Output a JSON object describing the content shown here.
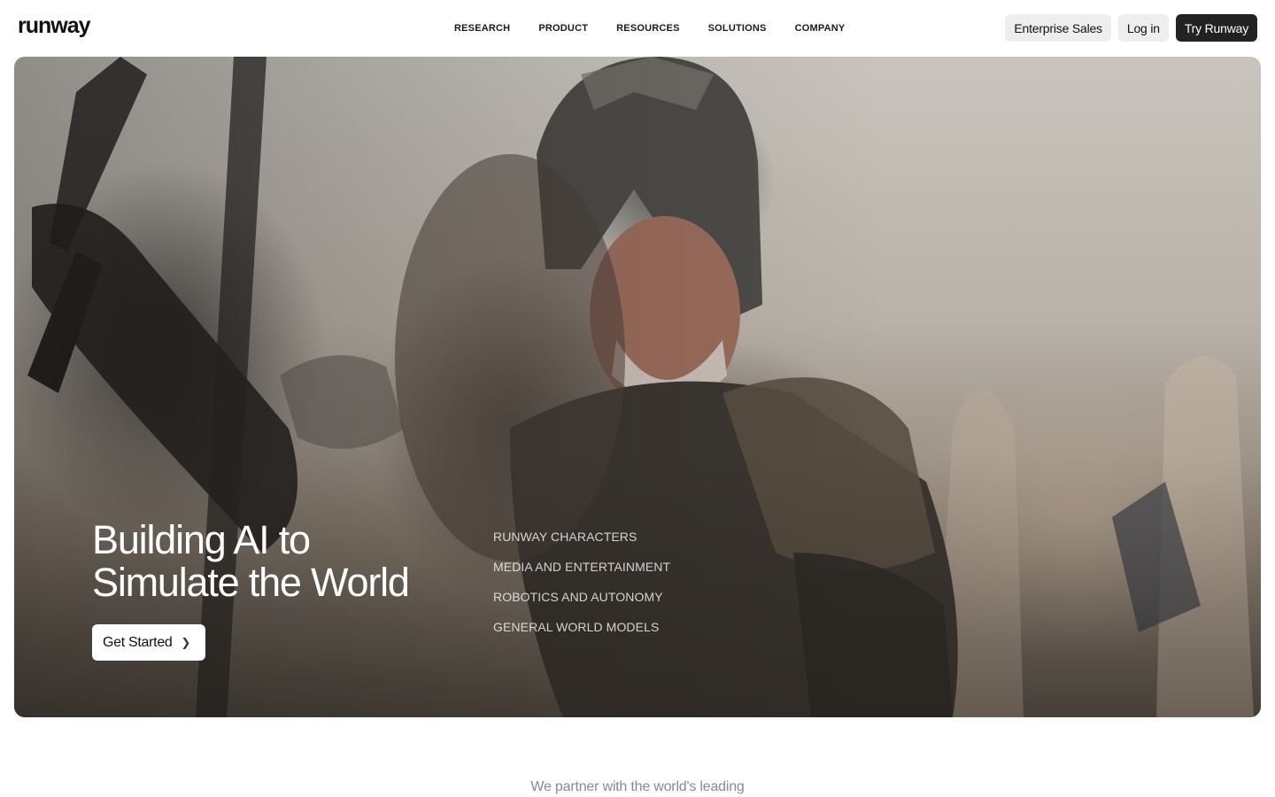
{
  "header": {
    "logo": "runway",
    "nav": [
      {
        "label": "RESEARCH"
      },
      {
        "label": "PRODUCT"
      },
      {
        "label": "RESOURCES"
      },
      {
        "label": "SOLUTIONS"
      },
      {
        "label": "COMPANY"
      }
    ],
    "actions": {
      "enterprise": "Enterprise Sales",
      "login": "Log in",
      "try": "Try Runway"
    }
  },
  "hero": {
    "headline_line1": "Building AI to",
    "headline_line2": "Simulate the World",
    "cta": "Get Started",
    "topics": [
      {
        "label": "RUNWAY CHARACTERS"
      },
      {
        "label": "MEDIA AND ENTERTAINMENT"
      },
      {
        "label": "ROBOTICS AND AUTONOMY"
      },
      {
        "label": "GENERAL WORLD MODELS"
      }
    ]
  },
  "partners": {
    "text": "We partner with the world's leading"
  }
}
